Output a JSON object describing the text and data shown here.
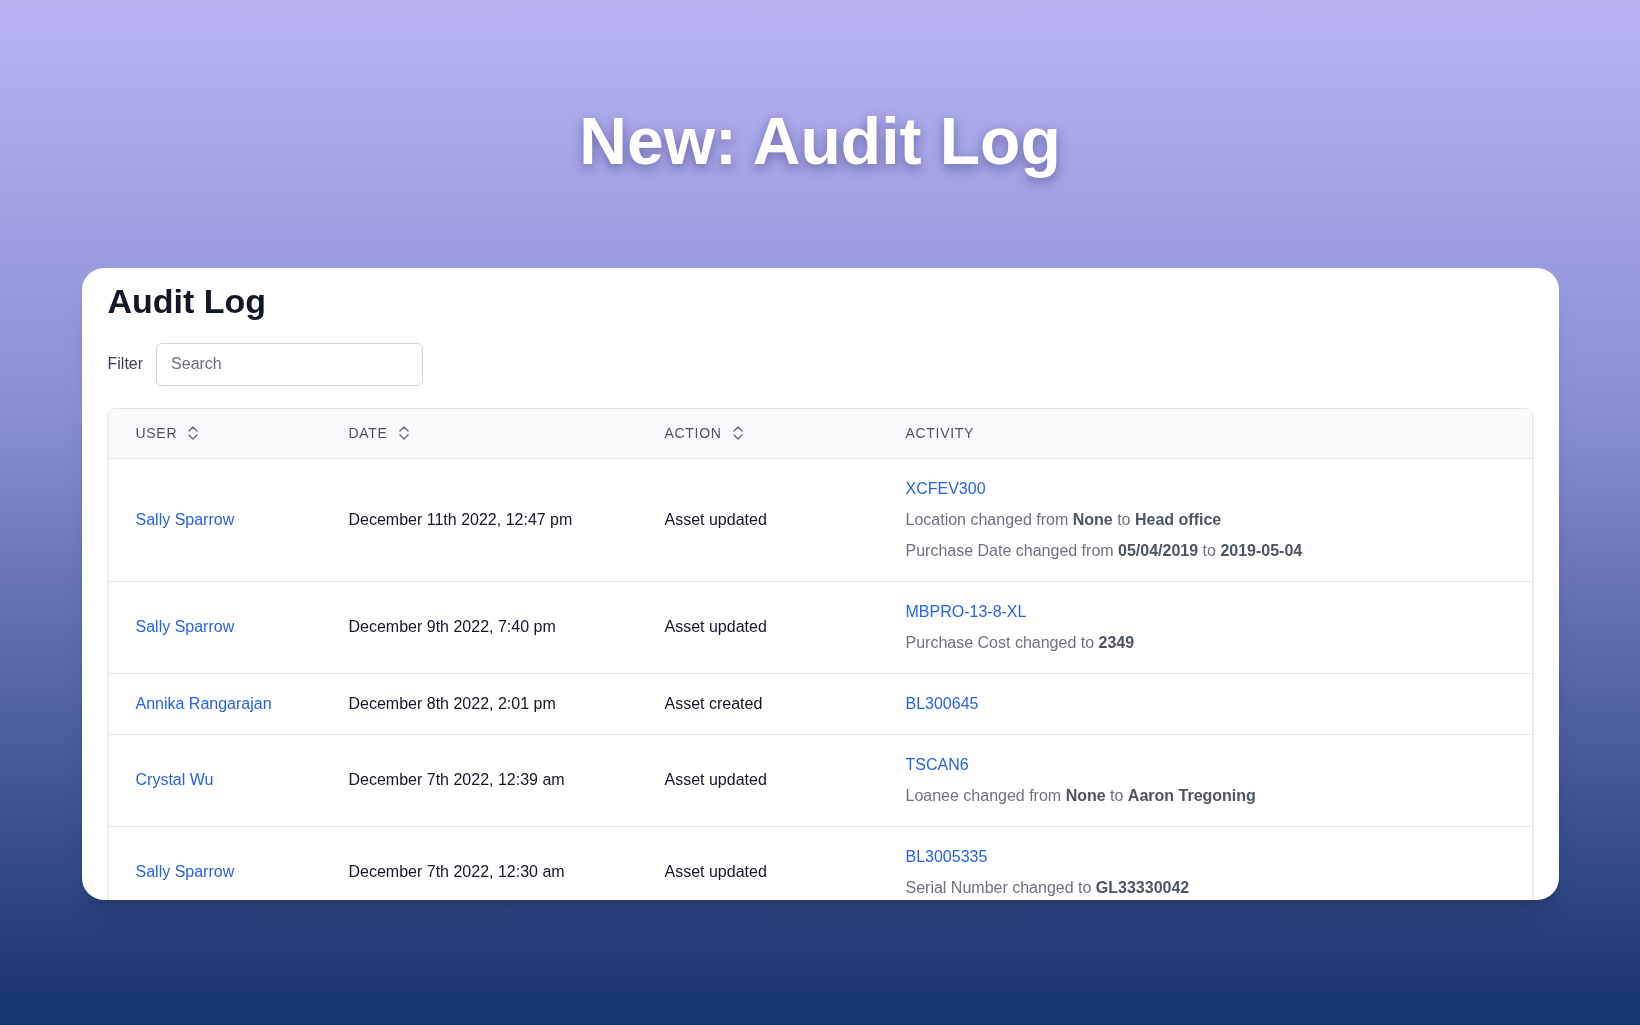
{
  "headline": "New: Audit Log",
  "page": {
    "title": "Audit Log",
    "filter": {
      "label": "Filter",
      "placeholder": "Search"
    }
  },
  "table": {
    "columns": [
      {
        "label": "USER",
        "sortable": true
      },
      {
        "label": "DATE",
        "sortable": true
      },
      {
        "label": "ACTION",
        "sortable": true
      },
      {
        "label": "ACTIVITY",
        "sortable": false
      }
    ],
    "rows": [
      {
        "user": "Sally Sparrow",
        "date": "December 11th 2022, 12:47 pm",
        "action": "Asset updated",
        "asset": "XCFEV300",
        "changes": [
          "Location changed from **None** to **Head office**",
          "Purchase Date changed from **05/04/2019** to **2019-05-04**"
        ]
      },
      {
        "user": "Sally Sparrow",
        "date": "December 9th 2022, 7:40 pm",
        "action": "Asset updated",
        "asset": "MBPRO-13-8-XL",
        "changes": [
          "Purchase Cost changed to **2349**"
        ]
      },
      {
        "user": "Annika Rangarajan",
        "date": "December 8th 2022, 2:01 pm",
        "action": "Asset created",
        "asset": "BL300645"
      },
      {
        "user": "Crystal Wu",
        "date": "December 7th 2022, 12:39 am",
        "action": "Asset updated",
        "asset": "TSCAN6",
        "changes": [
          "Loanee changed from **None** to **Aaron Tregoning**"
        ]
      },
      {
        "user": "Sally Sparrow",
        "date": "December 7th 2022, 12:30 am",
        "action": "Asset updated",
        "asset": "BL3005335",
        "changes": [
          "Serial Number changed to **GL33330042**"
        ]
      }
    ]
  }
}
